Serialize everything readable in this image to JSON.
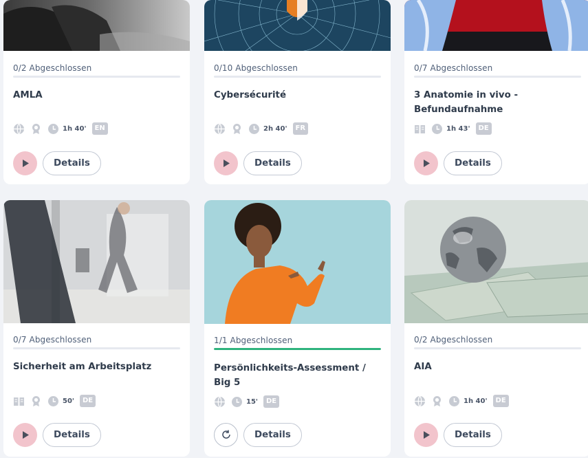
{
  "courses": [
    {
      "progress": "0/2 Abgeschlossen",
      "progress_fraction": 0,
      "title": "AMLA",
      "icons": [
        "globe-icon",
        "award-icon",
        "clock-icon"
      ],
      "duration": "1h 40'",
      "language": "EN",
      "action": "play",
      "details_label": "Details",
      "image": "dark bag on floor, blurred"
    },
    {
      "progress": "0/10 Abgeschlossen",
      "progress_fraction": 0,
      "title": "Cybersécurité",
      "icons": [
        "globe-icon",
        "award-icon",
        "clock-icon"
      ],
      "duration": "2h 40'",
      "language": "FR",
      "action": "play",
      "details_label": "Details",
      "image": "digital shield network"
    },
    {
      "progress": "0/7 Abgeschlossen",
      "progress_fraction": 0,
      "title": "3 Anatomie in vivo - Befundaufnahme",
      "icons": [
        "book-icon",
        "clock-icon"
      ],
      "duration": "1h 43'",
      "language": "DE",
      "action": "play",
      "details_label": "Details",
      "image": "anatomy illustration on red"
    },
    {
      "progress": "0/7 Abgeschlossen",
      "progress_fraction": 0,
      "title": "Sicherheit am Arbeitsplatz",
      "icons": [
        "book-icon",
        "award-icon",
        "clock-icon"
      ],
      "duration": "50'",
      "language": "DE",
      "action": "play",
      "details_label": "Details",
      "image": "people walking in office, motion blur"
    },
    {
      "progress": "1/1 Abgeschlossen",
      "progress_fraction": 1,
      "title": "Persönlichkeits-Assessment / Big 5",
      "icons": [
        "globe-icon",
        "clock-icon"
      ],
      "duration": "15'",
      "language": "DE",
      "action": "restart",
      "details_label": "Details",
      "image": "smiling woman in orange sweater pointing"
    },
    {
      "progress": "0/2 Abgeschlossen",
      "progress_fraction": 0,
      "title": "AIA",
      "icons": [
        "globe-icon",
        "award-icon",
        "clock-icon"
      ],
      "duration": "1h 40'",
      "language": "DE",
      "action": "play",
      "details_label": "Details",
      "image": "globe on banknotes"
    }
  ],
  "colors": {
    "accent_progress": "#2fb37d",
    "play_button": "#f2c4cc",
    "play_icon": "#4a4f5c",
    "language_badge": "#c8cbd3"
  }
}
